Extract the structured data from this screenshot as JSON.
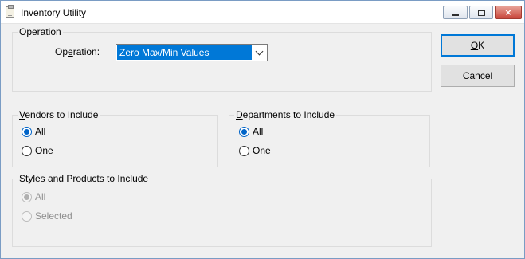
{
  "window": {
    "title": "Inventory Utility",
    "icon": "clipboard-icon",
    "controls": {
      "minimize": "minimize-icon",
      "maximize": "maximize-icon",
      "close": "×"
    }
  },
  "operation_group": {
    "title": "Operation",
    "label_pre": "Op",
    "label_accel": "e",
    "label_post": "ration:",
    "selected_value": "Zero Max/Min Values"
  },
  "vendors_group": {
    "title_accel": "V",
    "title_rest": "endors to Include",
    "options": [
      {
        "label": "All",
        "checked": true
      },
      {
        "label": "One",
        "checked": false
      }
    ]
  },
  "departments_group": {
    "title_accel": "D",
    "title_rest": "epartments to Include",
    "options": [
      {
        "label": "All",
        "checked": true
      },
      {
        "label": "One",
        "checked": false
      }
    ]
  },
  "styles_group": {
    "title": "Styles and Products to Include",
    "disabled": true,
    "options": [
      {
        "label": "All",
        "checked": true
      },
      {
        "label": "Selected",
        "checked": false
      }
    ]
  },
  "buttons": {
    "ok_accel": "O",
    "ok_rest": "K",
    "cancel": "Cancel"
  },
  "colors": {
    "selection": "#0078d7",
    "dialog_bg": "#f0f0f0",
    "close_button": "#c8453a"
  }
}
